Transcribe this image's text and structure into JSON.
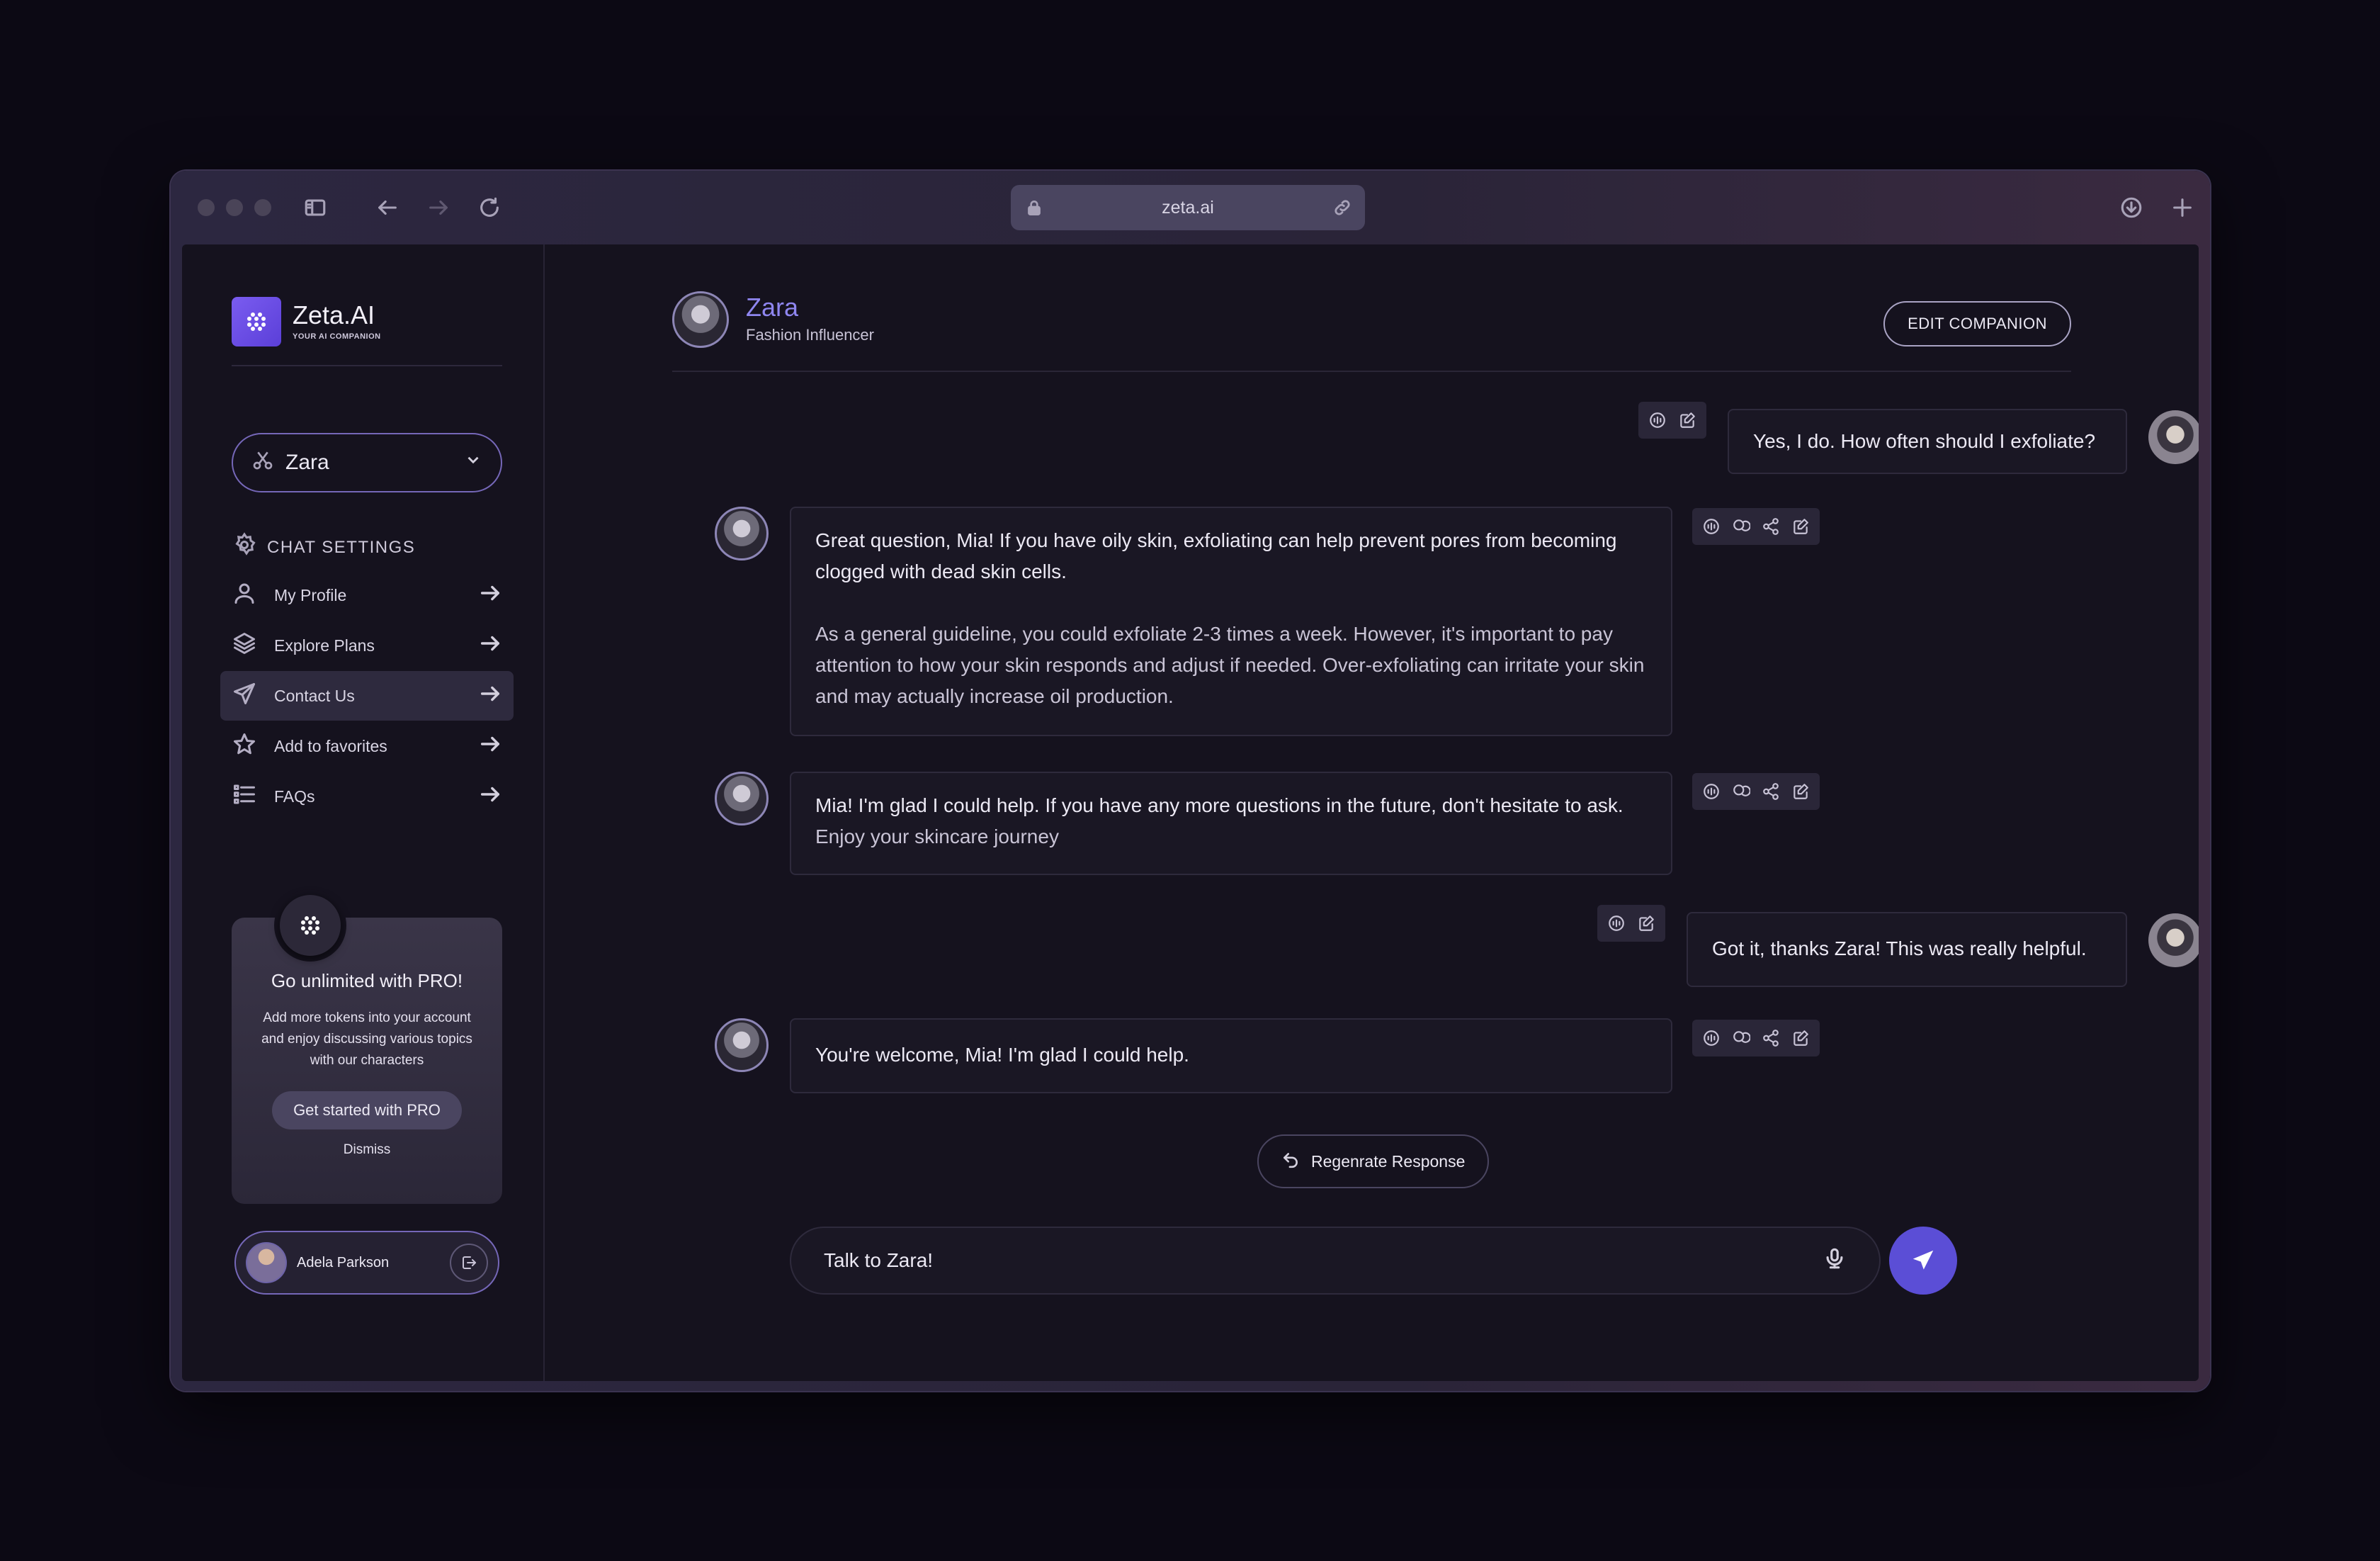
{
  "browser": {
    "url": "zeta.ai"
  },
  "brand": {
    "name": "Zeta.AI",
    "tagline": "YOUR AI COMPANION"
  },
  "character_select": {
    "value": "Zara"
  },
  "chat_settings": {
    "title": "CHAT SETTINGS",
    "items": [
      {
        "label": "My Profile",
        "icon": "user-icon"
      },
      {
        "label": "Explore Plans",
        "icon": "layers-icon"
      },
      {
        "label": "Contact Us",
        "icon": "send-icon"
      },
      {
        "label": "Add to favorites",
        "icon": "star-icon"
      },
      {
        "label": "FAQs",
        "icon": "list-icon"
      }
    ]
  },
  "pro_card": {
    "title": "Go unlimited with PRO!",
    "text": "Add more tokens into your account and enjoy discussing various topics with our characters",
    "cta": "Get started with PRO",
    "dismiss": "Dismiss"
  },
  "user": {
    "name": "Adela Parkson"
  },
  "chat": {
    "name": "Zara",
    "role": "Fashion Influencer",
    "edit_label": "EDIT COMPANION",
    "messages": [
      {
        "from": "user",
        "text": "Yes, I do. How often should I exfoliate?"
      },
      {
        "from": "bot",
        "paragraphs": [
          "Great question, Mia! If you have oily skin, exfoliating can help prevent pores from becoming clogged with dead skin cells.",
          "As a general guideline, you could exfoliate 2-3 times a week. However, it's important to pay attention to how your skin responds and adjust if needed. Over-exfoliating can irritate your skin and may actually increase oil production."
        ]
      },
      {
        "from": "bot",
        "text": "Mia! I'm glad I could help. If you have any more questions in the future, don't hesitate to ask.",
        "text2": "Enjoy your skincare journey"
      },
      {
        "from": "user",
        "text": "Got it, thanks Zara! This was really helpful."
      },
      {
        "from": "bot",
        "text": "You're welcome, Mia! I'm glad I could help."
      }
    ],
    "regenerate_label": "Regenrate Response",
    "input_placeholder": "Talk to Zara!"
  },
  "colors": {
    "accent": "#5b4ed6",
    "name_highlight": "#8f86f0",
    "background": "#15121e"
  }
}
